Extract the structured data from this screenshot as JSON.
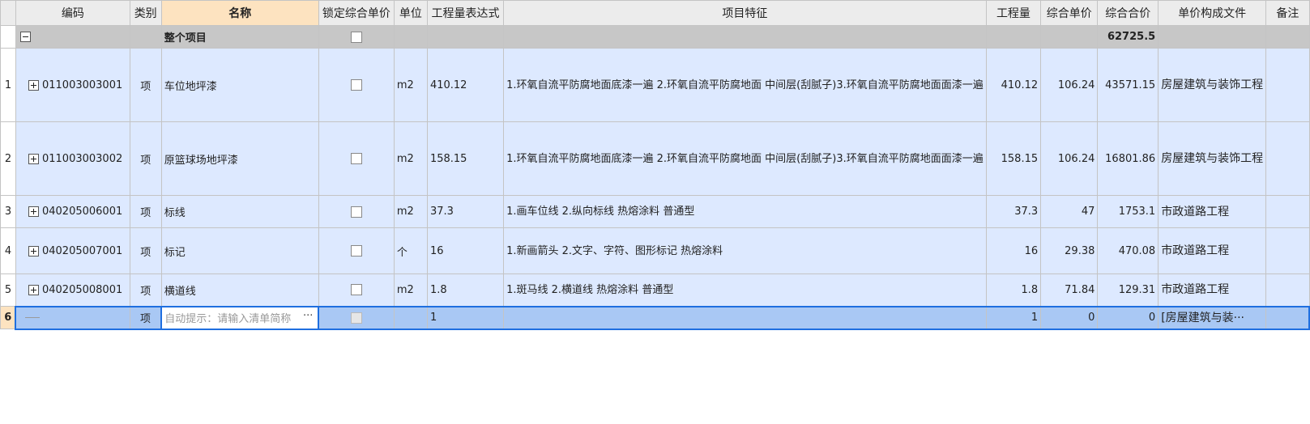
{
  "columns": {
    "code": "编码",
    "type": "类别",
    "name": "名称",
    "lock_price": "锁定综合单价",
    "unit": "单位",
    "qty_expr": "工程量表达式",
    "features": "项目特征",
    "quantity": "工程量",
    "unit_price": "综合单价",
    "total_price": "综合合价",
    "price_file": "单价构成文件",
    "remark": "备注"
  },
  "summary": {
    "name": "整个项目",
    "total_price": "62725.5"
  },
  "rows": [
    {
      "num": "1",
      "code": "011003003001",
      "type": "项",
      "name": "车位地坪漆",
      "unit": "m2",
      "qty_expr": "410.12",
      "features": "1.环氧自流平防腐地面底漆一遍 2.环氧自流平防腐地面 中间层(刮腻子)3.环氧自流平防腐地面面漆一遍",
      "quantity": "410.12",
      "unit_price": "106.24",
      "total_price": "43571.15",
      "price_file": "房屋建筑与装饰工程",
      "remark": ""
    },
    {
      "num": "2",
      "code": "011003003002",
      "type": "项",
      "name": "原篮球场地坪漆",
      "unit": "m2",
      "qty_expr": "158.15",
      "features": "1.环氧自流平防腐地面底漆一遍 2.环氧自流平防腐地面 中间层(刮腻子)3.环氧自流平防腐地面面漆一遍",
      "quantity": "158.15",
      "unit_price": "106.24",
      "total_price": "16801.86",
      "price_file": "房屋建筑与装饰工程",
      "remark": ""
    },
    {
      "num": "3",
      "code": "040205006001",
      "type": "项",
      "name": "标线",
      "unit": "m2",
      "qty_expr": "37.3",
      "features": "1.画车位线 2.纵向标线 热熔涂料 普通型",
      "quantity": "37.3",
      "unit_price": "47",
      "total_price": "1753.1",
      "price_file": "市政道路工程",
      "remark": ""
    },
    {
      "num": "4",
      "code": "040205007001",
      "type": "项",
      "name": "标记",
      "unit": "个",
      "qty_expr": "16",
      "features": "1.新画箭头 2.文字、字符、图形标记 热熔涂料",
      "quantity": "16",
      "unit_price": "29.38",
      "total_price": "470.08",
      "price_file": "市政道路工程",
      "remark": ""
    },
    {
      "num": "5",
      "code": "040205008001",
      "type": "项",
      "name": "横道线",
      "unit": "m2",
      "qty_expr": "1.8",
      "features": "1.斑马线 2.横道线 热熔涂料 普通型",
      "quantity": "1.8",
      "unit_price": "71.84",
      "total_price": "129.31",
      "price_file": "市政道路工程",
      "remark": ""
    }
  ],
  "active_row": {
    "num": "6",
    "type": "项",
    "name_placeholder": "自动提示：请输入清单简称",
    "ellipsis": "···",
    "qty_expr": "1",
    "quantity": "1",
    "unit_price": "0",
    "total_price": "0",
    "price_file": "[房屋建筑与装···"
  },
  "colors": {
    "data_row": "#dde9ff",
    "summary_row": "#c7c7c7",
    "selection_border": "#1f6fe0",
    "selected_header": "#fde3c0"
  }
}
